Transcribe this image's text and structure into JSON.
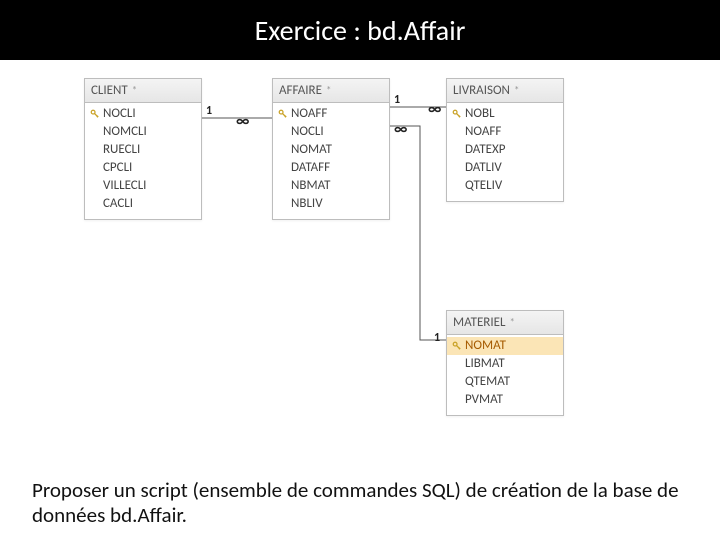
{
  "title": "Exercice : bd.Affair",
  "tables": {
    "client": {
      "name": "CLIENT",
      "fields": [
        {
          "name": "NOCLI",
          "pk": true
        },
        {
          "name": "NOMCLI",
          "pk": false
        },
        {
          "name": "RUECLI",
          "pk": false
        },
        {
          "name": "CPCLI",
          "pk": false
        },
        {
          "name": "VILLECLI",
          "pk": false
        },
        {
          "name": "CACLI",
          "pk": false
        }
      ]
    },
    "affaire": {
      "name": "AFFAIRE",
      "fields": [
        {
          "name": "NOAFF",
          "pk": true
        },
        {
          "name": "NOCLI",
          "pk": false
        },
        {
          "name": "NOMAT",
          "pk": false
        },
        {
          "name": "DATAFF",
          "pk": false
        },
        {
          "name": "NBMAT",
          "pk": false
        },
        {
          "name": "NBLIV",
          "pk": false
        }
      ]
    },
    "livraison": {
      "name": "LIVRAISON",
      "fields": [
        {
          "name": "NOBL",
          "pk": true
        },
        {
          "name": "NOAFF",
          "pk": false
        },
        {
          "name": "DATEXP",
          "pk": false
        },
        {
          "name": "DATLIV",
          "pk": false
        },
        {
          "name": "QTELIV",
          "pk": false
        }
      ]
    },
    "materiel": {
      "name": "MATERIEL",
      "fields": [
        {
          "name": "NOMAT",
          "pk": true,
          "selected": true
        },
        {
          "name": "LIBMAT",
          "pk": false
        },
        {
          "name": "QTEMAT",
          "pk": false
        },
        {
          "name": "PVMAT",
          "pk": false
        }
      ]
    }
  },
  "cardinality": {
    "one": "1",
    "many": "∞"
  },
  "footer": "Proposer un script (ensemble de commandes SQL) de création de la base de données bd.Affair."
}
